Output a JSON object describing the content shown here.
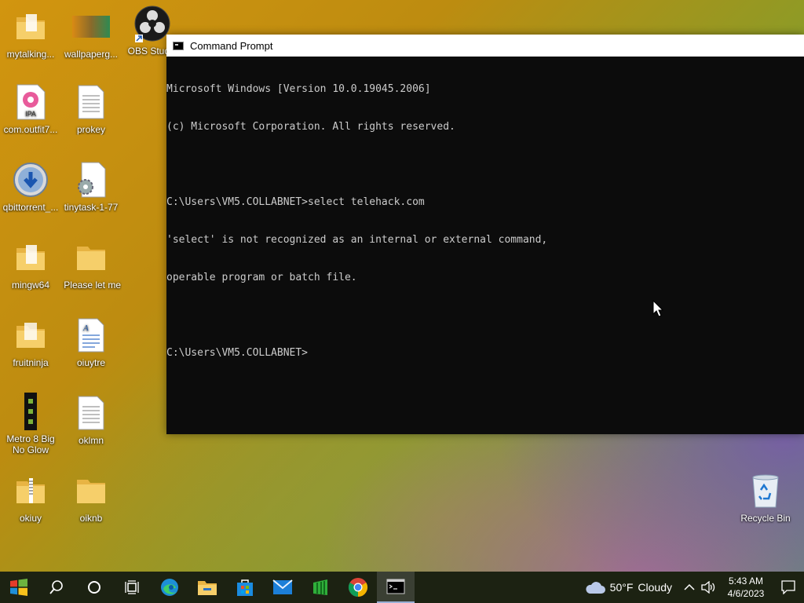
{
  "desktop": {
    "icons": [
      {
        "label": "mytalking...",
        "icon": "folder-icon"
      },
      {
        "label": "wallpaperg...",
        "icon": "image-thumbnail-icon"
      },
      {
        "label": "OBS Studio",
        "icon": "obs-icon"
      },
      {
        "label": "com.outfit7...",
        "icon": "ipa-file-icon"
      },
      {
        "label": "prokey",
        "icon": "text-document-icon"
      },
      {
        "label": "qbittorrent_...",
        "icon": "qbittorrent-icon"
      },
      {
        "label": "tinytask-1-77",
        "icon": "settings-file-icon"
      },
      {
        "label": "mingw64",
        "icon": "folder-icon"
      },
      {
        "label": "​ Please let me",
        "icon": "folder-icon"
      },
      {
        "label": "fruitninja",
        "icon": "folder-icon"
      },
      {
        "label": "oiuytre",
        "icon": "wordpad-document-icon"
      },
      {
        "label": "Metro 8 Big No Glow",
        "icon": "metro-app-icon"
      },
      {
        "label": "oklmn",
        "icon": "text-document-icon"
      },
      {
        "label": "okiuy",
        "icon": "zip-folder-icon"
      },
      {
        "label": "oiknb",
        "icon": "folder-icon"
      },
      {
        "label": "Recycle Bin",
        "icon": "recycle-bin-icon"
      }
    ]
  },
  "cmd_window": {
    "title": "Command Prompt",
    "lines": [
      "Microsoft Windows [Version 10.0.19045.2006]",
      "(c) Microsoft Corporation. All rights reserved.",
      "",
      "C:\\Users\\VM5.COLLABNET>select telehack.com",
      "'select' is not recognized as an internal or external command,",
      "operable program or batch file.",
      "",
      "C:\\Users\\VM5.COLLABNET>"
    ]
  },
  "taskbar": {
    "apps": [
      "start-icon",
      "search-icon",
      "cortana-icon",
      "task-view-icon",
      "edge-icon",
      "file-explorer-icon",
      "store-icon",
      "mail-icon",
      "green-app-icon",
      "chrome-icon",
      "cmd-icon"
    ],
    "weather": {
      "temperature": "50°F",
      "condition": "Cloudy"
    },
    "time": "5:43 AM",
    "date": "4/6/2023"
  },
  "colors": {
    "taskbar": "#1c2212",
    "console_bg": "#0c0c0c",
    "console_fg": "#cccccc",
    "folder": "#f6c95a"
  }
}
